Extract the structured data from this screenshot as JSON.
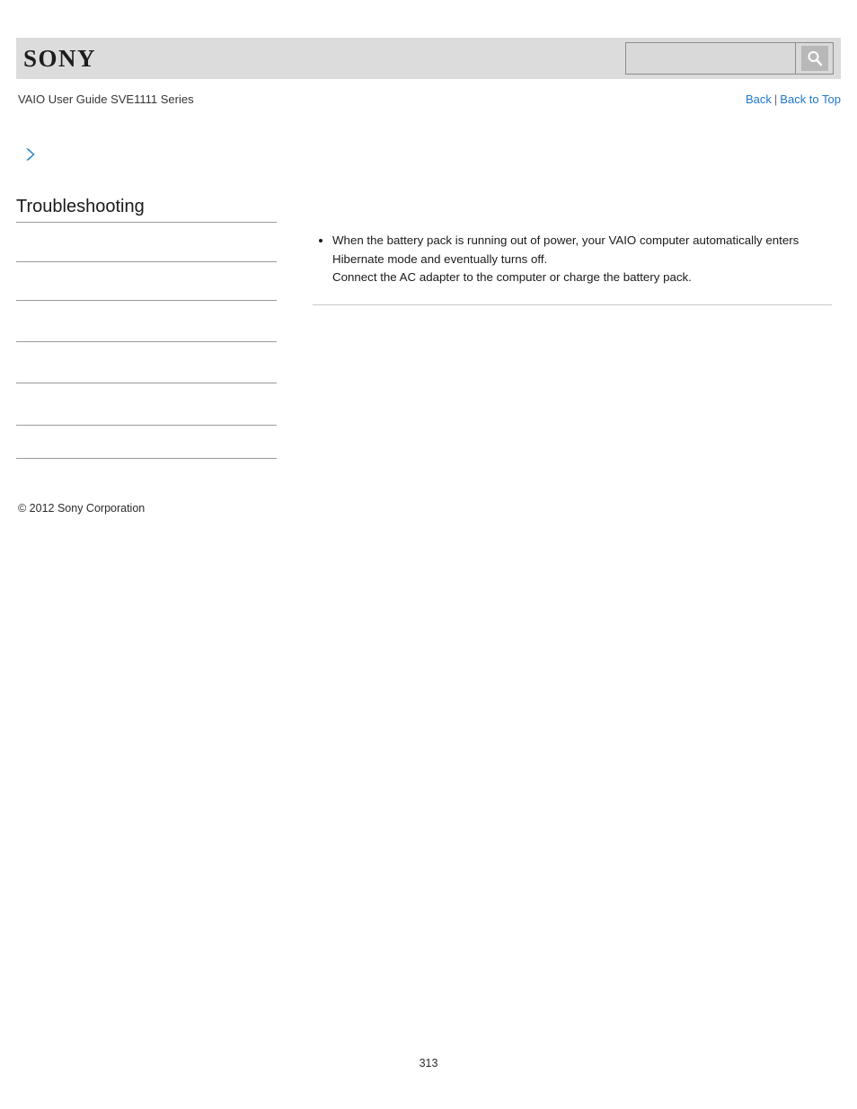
{
  "header": {
    "logo_text": "SONY",
    "band_color": "#dcdcdc"
  },
  "search": {
    "value": "",
    "placeholder": "",
    "icon": "search-icon",
    "button_label": ""
  },
  "titlebar": {
    "guide_title": "VAIO User Guide SVE1111 Series",
    "links": {
      "back": "Back",
      "separator": "|",
      "back_to_top": "Back to Top"
    },
    "link_color": "#1f76c8"
  },
  "breadcrumb": {
    "arrow_icon": "chevron-right-icon",
    "arrow_color": "#2a85c8",
    "label": ""
  },
  "sidebar": {
    "title": "Troubleshooting",
    "items": [
      {
        "label": ""
      },
      {
        "label": ""
      },
      {
        "label": ""
      },
      {
        "label": ""
      },
      {
        "label": ""
      },
      {
        "label": ""
      }
    ],
    "rule_color": "#9a9a9a"
  },
  "content": {
    "bullets": [
      "When the battery pack is running out of power, your VAIO computer automatically enters Hibernate mode and eventually turns off.\nConnect the AC adapter to the computer or charge the battery pack."
    ]
  },
  "footer": {
    "copyright": "© 2012 Sony Corporation",
    "page_number": "313"
  }
}
